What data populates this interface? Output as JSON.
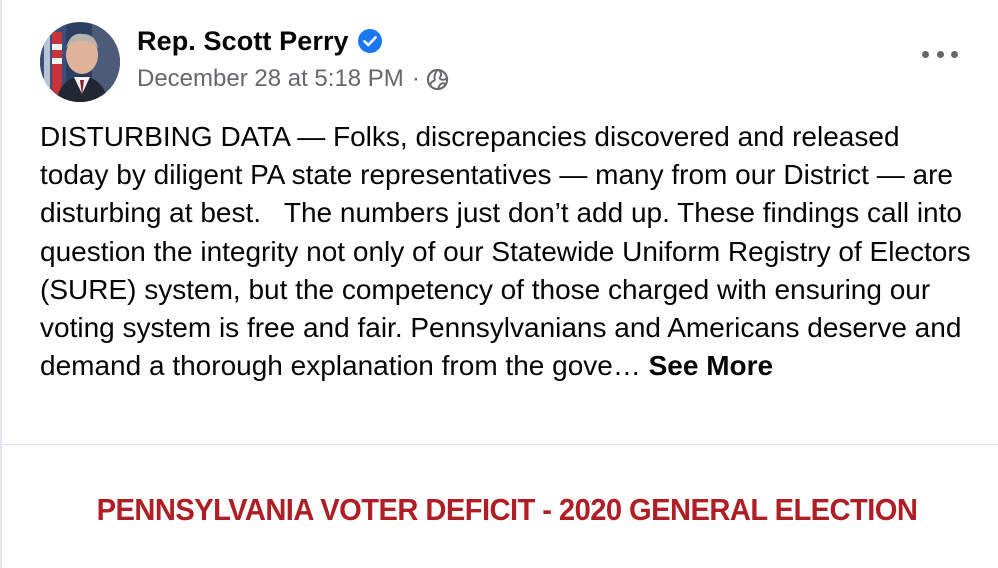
{
  "post": {
    "author": "Rep. Scott Perry",
    "timestamp": "December 28 at 5:18 PM",
    "meta_separator": "·",
    "icons": {
      "verified": "verified-badge-icon",
      "audience": "globe-icon",
      "options": "more-options-icon"
    },
    "text": "DISTURBING DATA — Folks, discrepancies discovered and released today by diligent PA state representatives — many from our District — are disturbing at best.   The numbers just don’t add up. These findings call into question the integrity not only of our Statewide Uniform Registry of Electors (SURE) system, but the competency of those charged with ensuring our voting system is free and fair. Pennsylvanians and Americans deserve and demand a thorough explanation from the gove… ",
    "see_more": "See More"
  },
  "attachment": {
    "title": "PENNSYLVANIA VOTER DEFICIT - 2020 GENERAL ELECTION"
  },
  "colors": {
    "text_primary": "#050505",
    "text_secondary": "#65676b",
    "verified_blue": "#1877f2",
    "headline_red": "#b01e25"
  }
}
